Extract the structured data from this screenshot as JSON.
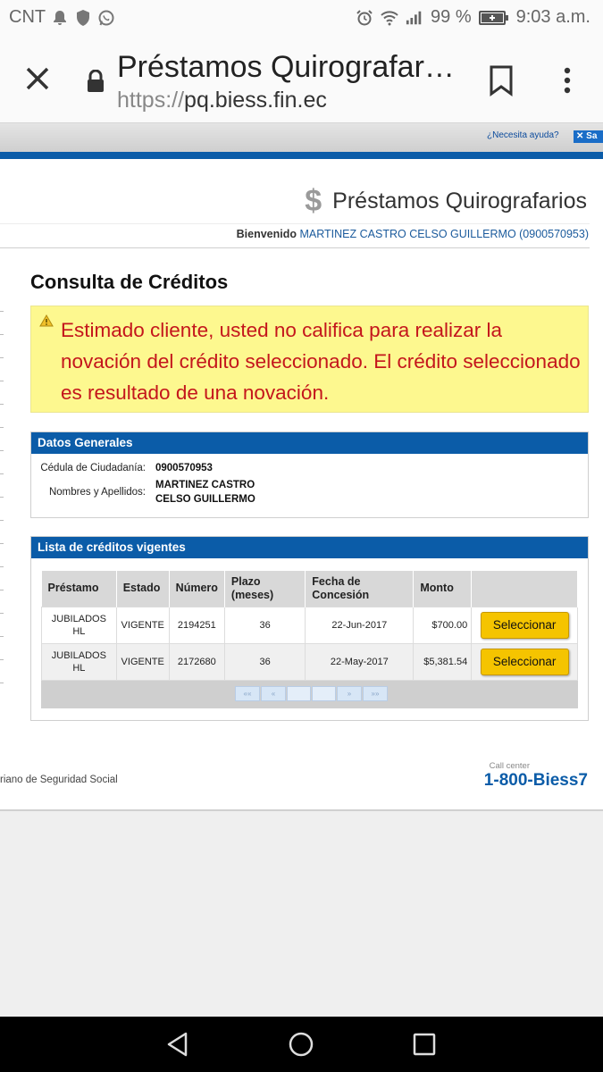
{
  "status_bar": {
    "carrier": "CNT",
    "battery": "99 %",
    "time": "9:03 a.m.",
    "icons": [
      "notification-bell-icon",
      "shield-icon",
      "whatsapp-icon",
      "alarm-icon",
      "wifi-icon",
      "signal-icon",
      "battery-icon"
    ]
  },
  "browser": {
    "title": "Préstamos Quirografarios",
    "url_scheme": "https://",
    "url_host": "pq.biess.fin.ec",
    "icons": [
      "close-icon",
      "lock-icon",
      "bookmark-icon",
      "more-vert-icon"
    ]
  },
  "help_strip": {
    "help_link": "¿Necesita ayuda?",
    "x_button": "✕ Sa"
  },
  "header": {
    "site_title": "Préstamos Quirografarios",
    "dollar_glyph": "$",
    "welcome_label": "Bienvenido",
    "user": "MARTINEZ CASTRO CELSO GUILLERMO (0900570953)"
  },
  "main": {
    "heading": "Consulta de Créditos",
    "alert": "Estimado cliente, usted no califica para realizar la novación del crédito seleccionado. El crédito seleccionado es resultado de una novación.",
    "datos": {
      "title": "Datos Generales",
      "cedula_label": "Cédula de Ciudadanía:",
      "cedula_value": "0900570953",
      "nombres_label": "Nombres y Apellidos:",
      "nombres_line1": "MARTINEZ CASTRO",
      "nombres_line2": "CELSO GUILLERMO"
    },
    "lista": {
      "title": "Lista de créditos vigentes",
      "columns": [
        "Préstamo",
        "Estado",
        "Número",
        "Plazo (meses)",
        "Fecha de Concesión",
        "Monto",
        ""
      ],
      "rows": [
        {
          "prestamo": "JUBILADOS HL",
          "estado": "VIGENTE",
          "numero": "2194251",
          "plazo": "36",
          "fecha": "22-Jun-2017",
          "monto": "$700.00",
          "action": "Seleccionar"
        },
        {
          "prestamo": "JUBILADOS HL",
          "estado": "VIGENTE",
          "numero": "2172680",
          "plazo": "36",
          "fecha": "22-May-2017",
          "monto": "$5,381.54",
          "action": "Seleccionar"
        }
      ],
      "pager": [
        "««",
        "«",
        "",
        "",
        "»",
        "»»"
      ]
    }
  },
  "footer": {
    "institution": "riano de Seguridad Social",
    "call_center_label": "Call center",
    "call_center_number": "1-800-Biess7"
  },
  "nav_bar": {
    "icons": [
      "back-icon",
      "home-icon",
      "recents-icon"
    ]
  }
}
